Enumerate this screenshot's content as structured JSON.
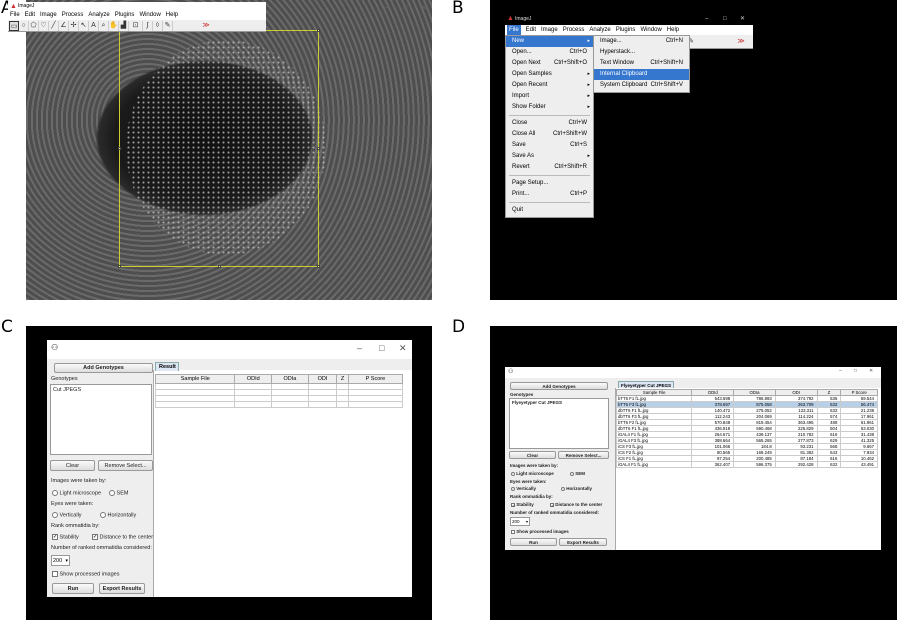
{
  "panels": {
    "a_label": "A",
    "b_label": "B",
    "c_label": "C",
    "d_label": "D"
  },
  "imagej": {
    "title": "ImageJ",
    "menu": [
      "File",
      "Edit",
      "Image",
      "Process",
      "Analyze",
      "Plugins",
      "Window",
      "Help"
    ],
    "win_min": "–",
    "win_max": "□",
    "win_close": "✕"
  },
  "file_menu": {
    "items": [
      {
        "label": "New",
        "shortcut": "",
        "submenu": true,
        "highlight": true
      },
      {
        "label": "Open...",
        "shortcut": "Ctrl+O"
      },
      {
        "label": "Open Next",
        "shortcut": "Ctrl+Shift+O"
      },
      {
        "label": "Open Samples",
        "submenu": true
      },
      {
        "label": "Open Recent",
        "submenu": true
      },
      {
        "label": "Import",
        "submenu": true
      },
      {
        "label": "Show Folder",
        "submenu": true
      },
      {
        "label": "Close",
        "shortcut": "Ctrl+W"
      },
      {
        "label": "Close All",
        "shortcut": "Ctrl+Shift+W"
      },
      {
        "label": "Save",
        "shortcut": "Ctrl+S"
      },
      {
        "label": "Save As",
        "submenu": true
      },
      {
        "label": "Revert",
        "shortcut": "Ctrl+Shift+R"
      },
      {
        "label": "Page Setup..."
      },
      {
        "label": "Print...",
        "shortcut": "Ctrl+P"
      },
      {
        "label": "Quit"
      }
    ]
  },
  "new_submenu": {
    "items": [
      {
        "label": "Image...",
        "shortcut": "Ctrl+N"
      },
      {
        "label": "Hyperstack..."
      },
      {
        "label": "Text Window",
        "shortcut": "Ctrl+Shift+N"
      },
      {
        "label": "Internal Clipboard",
        "highlight": true
      },
      {
        "label": "System Clipboard",
        "shortcut": "Ctrl+Shift+V"
      }
    ]
  },
  "flyeyes_c": {
    "add_genotypes": "Add Genotypes",
    "genotypes_label": "Genotypes",
    "genotype_item": "Cut JPEGS",
    "clear": "Clear",
    "remove_select": "Remove Select...",
    "taken_by": "Images were taken by:",
    "light_microscope": "Light microscope",
    "sem": "SEM",
    "eyes_taken": "Eyes were taken:",
    "vertically": "Vertically",
    "horizontally": "Horizontally",
    "rank_by": "Rank ommatidia by:",
    "stability": "Stability",
    "distance_center": "Distance to the center",
    "number_ranked": "Number of ranked ommatidia considered:",
    "number_value": "200",
    "show_processed": "Show processed images",
    "run": "Run",
    "export": "Export Results",
    "result_tab": "Result",
    "columns": [
      "Sample File",
      "ODId",
      "ODIa",
      "ODI",
      "Z",
      "P Score"
    ]
  },
  "flyeyes_d": {
    "add_genotypes": "Add Genotypes",
    "genotypes_label": "Genotypes",
    "genotype_item": "Flyeyetyper Cut JPEGS",
    "clear": "Clear",
    "remove_select": "Remove Select...",
    "taken_by": "Images were taken by:",
    "light_microscope": "Light microscope",
    "sem": "SEM",
    "eyes_taken": "Eyes were taken:",
    "vertically": "Vertically",
    "horizontally": "Horizontally",
    "rank_by": "Rank ommatidia by:",
    "stability": "Stability",
    "distance_center": "Distance to the center",
    "number_ranked": "Number of ranked ommatidia considered:",
    "number_value": "200",
    "show_processed": "Show processed images",
    "run": "Run",
    "export": "Export Results",
    "result_tab": "Flyeyetyper Cut JPEGS",
    "columns": [
      "Sample File",
      "ODId",
      "ODIa",
      "ODI",
      "Z",
      "P Score"
    ],
    "rows": [
      [
        "bTT6 F1 fL.jpg",
        "543.598",
        "786.893",
        "374.792",
        "535",
        "59.544"
      ],
      [
        "bTT6 F3 fL.jpg",
        "378.697",
        "875.058",
        "263.709",
        "632",
        "56.474"
      ],
      [
        "dbTT6 F1 fL.jpg",
        "140.472",
        "275.052",
        "133.311",
        "532",
        "21.238"
      ],
      [
        "dbTT6 F3 fL.jpg",
        "112.243",
        "204.069",
        "114.224",
        "574",
        "17.961"
      ],
      [
        "bTT6 F2 fL.jpg",
        "570.848",
        "819.454",
        "363.495",
        "488",
        "61.961"
      ],
      [
        "dbTT6 F1 fL.jpg",
        "436.918",
        "590.468",
        "225.829",
        "504",
        "53.030"
      ],
      [
        "iGAL4 F1 fL.jpg",
        "264.671",
        "439.137",
        "210.782",
        "616",
        "31.438"
      ],
      [
        "iGAL4 F3 fL.jpg",
        "388.664",
        "565.265",
        "277.873",
        "629",
        "41.325"
      ],
      [
        "iCS F3 fL.jpg",
        "101.066",
        "184.8",
        "93.231",
        "568",
        "9.667"
      ],
      [
        "iCS F2 fL.jpg",
        "80.565",
        "168.249",
        "81.382",
        "643",
        "7.934"
      ],
      [
        "iCS F1 fL.jpg",
        "97.254",
        "200.485",
        "87.184",
        "616",
        "10.462"
      ],
      [
        "iGAL4 F1 fL.jpg",
        "362.407",
        "596.375",
        "292.428",
        "632",
        "43.491"
      ]
    ]
  },
  "colors": {
    "menu_highlight": "#3576cf",
    "roi": "#cccc33",
    "background_dark": "#000000"
  }
}
